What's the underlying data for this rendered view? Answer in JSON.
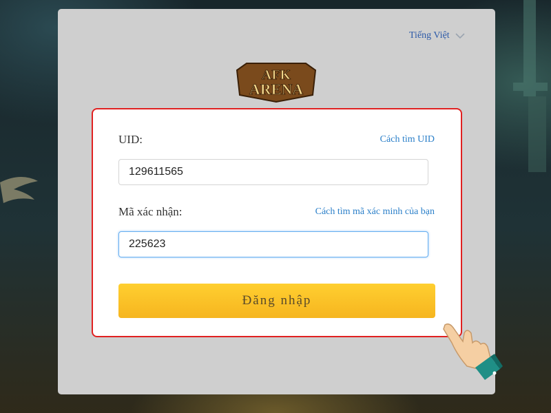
{
  "language": {
    "label": "Tiếng Việt"
  },
  "logo": {
    "text_top": "AFK",
    "text_bottom": "ARENA"
  },
  "form": {
    "uid_label": "UID:",
    "uid_help_link": "Cách tìm UID",
    "uid_value": "129611565",
    "code_label": "Mã xác nhận:",
    "code_help_link": "Cách tìm mã xác minh của bạn",
    "code_value": "225623",
    "submit_label": "Đăng nhập"
  },
  "colors": {
    "card_border": "#e02020",
    "link": "#2a7fc9",
    "button": "#f8bd22",
    "panel": "#cfcfcf"
  },
  "icons": [
    "chevron-down-icon",
    "pointing-hand-icon"
  ]
}
